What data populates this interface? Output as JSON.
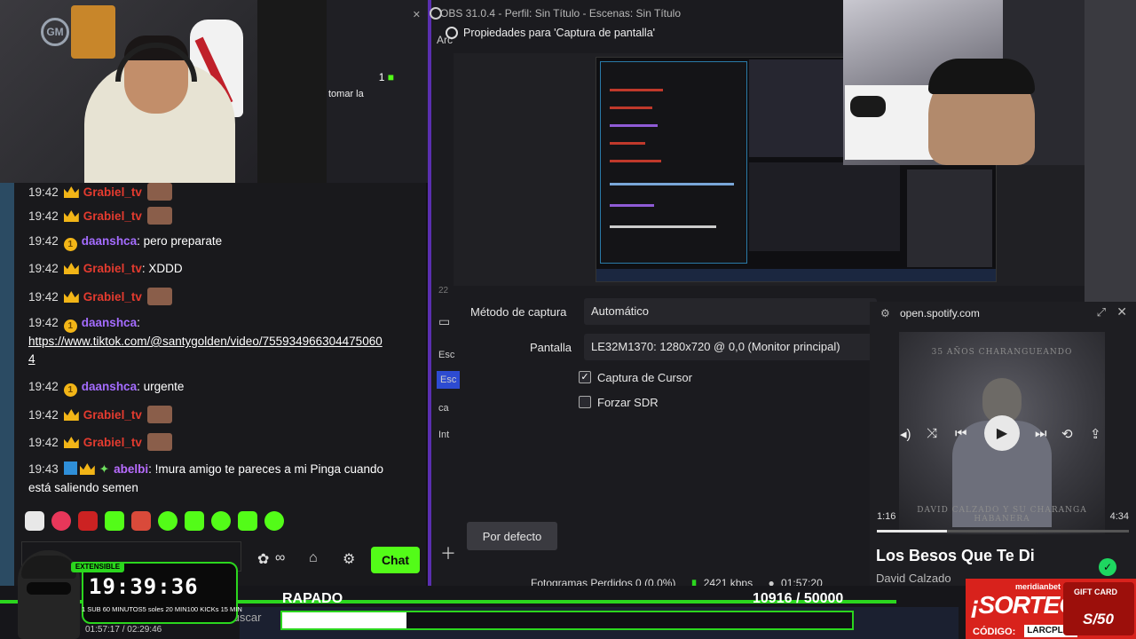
{
  "obs": {
    "window_title": "OBS 31.0.4 - Perfil: Sin Título - Escenas: Sin Título",
    "menu_fragment": "Arc",
    "dialog_title": "Propiedades para 'Captura de pantalla'",
    "capture_method_label": "Método de captura",
    "capture_method_value": "Automático",
    "screen_label": "Pantalla",
    "screen_value": "LE32M1370: 1280x720 @ 0,0 (Monitor principal)",
    "cursor_capture_label": "Captura de Cursor",
    "cursor_capture_checked": true,
    "force_sdr_label": "Forzar SDR",
    "force_sdr_checked": false,
    "default_button": "Por defecto",
    "side_items": [
      "Esc",
      "Esc",
      "ca",
      "Int"
    ],
    "side_number": "22",
    "status": {
      "dropped_frames": "Fotogramas Perdidos 0 (0.0%)",
      "bitrate": "2421 kbps",
      "time": "01:57:20"
    }
  },
  "middle_strip": {
    "count": "1",
    "text": "tomar la"
  },
  "chat": {
    "messages": [
      {
        "time": "19:42",
        "user": "Grabiel_tv",
        "text": ""
      },
      {
        "time": "19:42",
        "user": "Grabiel_tv",
        "text": ""
      },
      {
        "time": "19:42",
        "user": "daanshca",
        "text": ": pero preparate"
      },
      {
        "time": "19:42",
        "user": "Grabiel_tv",
        "text": ": XDDD"
      },
      {
        "time": "19:42",
        "user": "Grabiel_tv",
        "text": ""
      },
      {
        "time": "19:42",
        "user": "daanshca",
        "text": ":"
      },
      {
        "link": "https://www.tiktok.com/@santygolden/video/755934966304475060",
        "link2": "4"
      },
      {
        "time": "19:42",
        "user": "daanshca",
        "text": ": urgente"
      },
      {
        "time": "19:42",
        "user": "Grabiel_tv",
        "text": ""
      },
      {
        "time": "19:42",
        "user": "Grabiel_tv",
        "text": ""
      },
      {
        "time": "19:43",
        "user": "abelbi",
        "text": ": !mura amigo te pareces a mi Pinga cuando",
        "text2": "está saliendo semen"
      }
    ],
    "send_button": "Chat"
  },
  "spotify": {
    "url": "open.spotify.com",
    "song_title": "Los Besos Que Te Di",
    "artist": "David Calzado",
    "elapsed": "1:16",
    "total": "4:34",
    "progress": 0.277,
    "album_text_top": "35 AÑOS CHARANGUEANDO",
    "album_text_bottom": "DAVID CALZADO Y SU CHARANGA HABANERA"
  },
  "overlay": {
    "timer_tag": "EXTENSIBLE",
    "timer": "19:39:36",
    "timer_stats": [
      "1 SUB 60 MINUTOS",
      "5 soles 20 MIN",
      "100 KICKs 15 MIN"
    ],
    "bottom_time": "01:57:17 / 02:29:46",
    "goal_label": "RAPADO",
    "goal_current": "10916",
    "goal_target": "50000",
    "goal_display": "10916 / 50000",
    "taskbar_search": "Buscar",
    "sorteo_brand": "meridianbet",
    "sorteo_title": "¡SORTEO!",
    "sorteo_code_label": "CÓDIGO:",
    "sorteo_code": "LARCPLAY",
    "gift_card": "GIFT CARD",
    "gift_amount": "S/50"
  },
  "colors": {
    "kick_green": "#53fc18",
    "obs_bg": "#1b1b1f",
    "username_red": "#e33b2f",
    "username_purple": "#a46cff",
    "sorteo_red": "#d8221c"
  }
}
